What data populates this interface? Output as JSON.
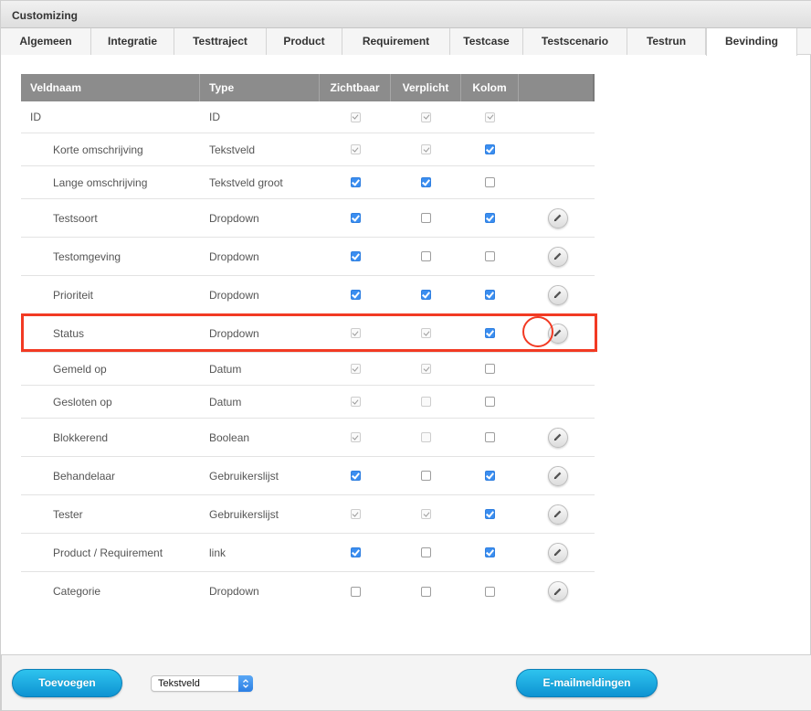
{
  "window": {
    "title": "Customizing"
  },
  "tabs": [
    {
      "label": "Algemeen",
      "active": false
    },
    {
      "label": "Integratie",
      "active": false
    },
    {
      "label": "Testtraject",
      "active": false
    },
    {
      "label": "Product",
      "active": false
    },
    {
      "label": "Requirement",
      "active": false
    },
    {
      "label": "Testcase",
      "active": false
    },
    {
      "label": "Testscenario",
      "active": false
    },
    {
      "label": "Testrun",
      "active": false
    },
    {
      "label": "Bevinding",
      "active": true
    }
  ],
  "table": {
    "headers": {
      "veldnaam": "Veldnaam",
      "type": "Type",
      "zichtbaar": "Zichtbaar",
      "verplicht": "Verplicht",
      "kolom": "Kolom",
      "actions": ""
    },
    "rows": [
      {
        "name": "ID",
        "type": "ID",
        "zichtbaar": "disabled-checked",
        "verplicht": "disabled-checked",
        "kolom": "disabled-checked",
        "editable": false,
        "root": true
      },
      {
        "name": "Korte omschrijving",
        "type": "Tekstveld",
        "zichtbaar": "disabled-checked",
        "verplicht": "disabled-checked",
        "kolom": "checked",
        "editable": false
      },
      {
        "name": "Lange omschrijving",
        "type": "Tekstveld groot",
        "zichtbaar": "checked",
        "verplicht": "checked",
        "kolom": "unchecked",
        "editable": false
      },
      {
        "name": "Testsoort",
        "type": "Dropdown",
        "zichtbaar": "checked",
        "verplicht": "unchecked",
        "kolom": "checked",
        "editable": true
      },
      {
        "name": "Testomgeving",
        "type": "Dropdown",
        "zichtbaar": "checked",
        "verplicht": "unchecked",
        "kolom": "unchecked",
        "editable": true
      },
      {
        "name": "Prioriteit",
        "type": "Dropdown",
        "zichtbaar": "checked",
        "verplicht": "checked",
        "kolom": "checked",
        "editable": true
      },
      {
        "name": "Status",
        "type": "Dropdown",
        "zichtbaar": "disabled-checked",
        "verplicht": "disabled-checked",
        "kolom": "checked",
        "editable": true,
        "highlighted": true
      },
      {
        "name": "Gemeld op",
        "type": "Datum",
        "zichtbaar": "disabled-checked",
        "verplicht": "disabled-checked",
        "kolom": "unchecked",
        "editable": false
      },
      {
        "name": "Gesloten op",
        "type": "Datum",
        "zichtbaar": "disabled-checked",
        "verplicht": "disabled-unchecked",
        "kolom": "unchecked",
        "editable": false
      },
      {
        "name": "Blokkerend",
        "type": "Boolean",
        "zichtbaar": "disabled-checked",
        "verplicht": "disabled-unchecked",
        "kolom": "unchecked",
        "editable": true
      },
      {
        "name": "Behandelaar",
        "type": "Gebruikerslijst",
        "zichtbaar": "checked",
        "verplicht": "unchecked",
        "kolom": "checked",
        "editable": true
      },
      {
        "name": "Tester",
        "type": "Gebruikerslijst",
        "zichtbaar": "disabled-checked",
        "verplicht": "disabled-checked",
        "kolom": "checked",
        "editable": true
      },
      {
        "name": "Product / Requirement",
        "type": "link",
        "zichtbaar": "checked",
        "verplicht": "unchecked",
        "kolom": "checked",
        "editable": true
      },
      {
        "name": "Categorie",
        "type": "Dropdown",
        "zichtbaar": "unchecked",
        "verplicht": "unchecked",
        "kolom": "unchecked",
        "editable": true
      }
    ]
  },
  "footer": {
    "add_label": "Toevoegen",
    "type_select": {
      "value": "Tekstveld"
    },
    "email_label": "E-mailmeldingen"
  },
  "colors": {
    "accent": "#1aa8e0",
    "highlight": "#f23a23",
    "checkbox": "#3b8ef0",
    "header": "#8c8c8c"
  }
}
